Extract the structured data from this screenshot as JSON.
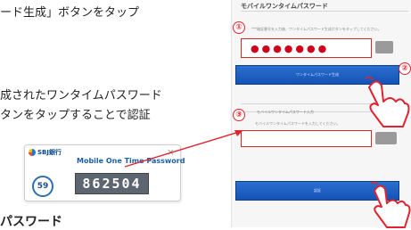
{
  "instructions": {
    "line1": "ード生成」ボタンをタップ",
    "line2": "成されたワンタイムパスワード",
    "line3": "タンをタップすることで認証",
    "cut_bottom": "パスワード"
  },
  "token_card": {
    "bank_name": "SBJ銀行",
    "title": "Mobile One Time Password",
    "countdown": "59",
    "token_value": "862504",
    "close_glyph": "×"
  },
  "panel": {
    "title": "モバイルワンタイムパスワード",
    "note1": "***暗証番号を入力後、ワンタイムパスワード生成ボタンをタップしてください。",
    "password_dots": "●●●●●●●",
    "issue_button": "ワンタイムパスワード生成",
    "section2_label": "モバイルワンタイムパスワード入力",
    "note2": "モバイルワンタイムパスワードを入力してください。",
    "auth_button": "認証"
  },
  "markers": {
    "one": "①",
    "two": "②",
    "three": "③"
  },
  "colors": {
    "accent_red": "#e0232e",
    "button_blue": "#1453b5",
    "token_box": "#5d6670"
  }
}
